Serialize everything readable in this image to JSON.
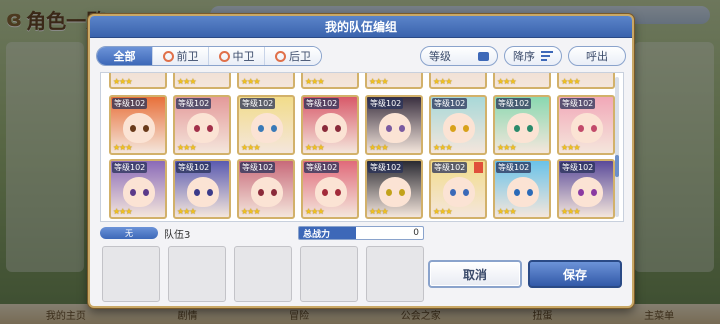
{
  "background": {
    "title": "角色一覧",
    "bottom_nav": [
      "我的主页",
      "剧情",
      "冒险",
      "公会之家",
      "扭蛋",
      "主菜单"
    ]
  },
  "dialog": {
    "title": "我的队伍编组",
    "tabs": [
      {
        "label": "全部",
        "active": true
      },
      {
        "label": "前卫",
        "active": false
      },
      {
        "label": "中卫",
        "active": false
      },
      {
        "label": "后卫",
        "active": false
      }
    ],
    "level_label": "等级",
    "sort_label": "降序",
    "call_label": "呼出",
    "level_prefix": "等级102",
    "party_tag": "无",
    "party_name": "队伍3",
    "power_label": "总战力",
    "power_value": "0",
    "cancel_label": "取消",
    "save_label": "保存"
  },
  "roster": {
    "partial_top_stars": [
      "★★★",
      "★★★",
      "★★★",
      "★★★",
      "★★★",
      "★★★",
      "★★★",
      "★★★"
    ],
    "row1": [
      {
        "level": "等级102",
        "stars": "★★★",
        "hair": "#e8703a",
        "eye": "#6a3a1a"
      },
      {
        "level": "等级102",
        "stars": "★★★",
        "hair": "#e49a9a",
        "eye": "#a2304a"
      },
      {
        "level": "等级102",
        "stars": "★★★",
        "hair": "#f2dc8a",
        "eye": "#3a7ab8"
      },
      {
        "level": "等级102",
        "stars": "★★★",
        "hair": "#d85a6a",
        "eye": "#8a2a3a"
      },
      {
        "level": "等级102",
        "stars": "★★★",
        "hair": "#3a3040",
        "eye": "#7a5aa0"
      },
      {
        "level": "等级102",
        "stars": "★★★",
        "hair": "#a8d8d8",
        "eye": "#d8a21a"
      },
      {
        "level": "等级102",
        "stars": "★★★",
        "hair": "#8ad8b0",
        "eye": "#2a8a6a"
      },
      {
        "level": "等级102",
        "stars": "★★★",
        "hair": "#f2a8b8",
        "eye": "#c24a6a"
      }
    ],
    "row2": [
      {
        "level": "等级102",
        "stars": "★★★",
        "hair": "#8a6ab8",
        "eye": "#5a3a8a",
        "flag": false
      },
      {
        "level": "等级102",
        "stars": "★★★",
        "hair": "#5a5ab0",
        "eye": "#3a3a8a",
        "flag": false
      },
      {
        "level": "等级102",
        "stars": "★★★",
        "hair": "#c86a7a",
        "eye": "#8a2a3a",
        "flag": false
      },
      {
        "level": "等级102",
        "stars": "★★★",
        "hair": "#e06a7a",
        "eye": "#a22a3a",
        "flag": false
      },
      {
        "level": "等级102",
        "stars": "★★★",
        "hair": "#2a2a32",
        "eye": "#c2a21a",
        "flag": false
      },
      {
        "level": "等级102",
        "stars": "★★★",
        "hair": "#f2dc8a",
        "eye": "#3a6ab8",
        "flag": true
      },
      {
        "level": "等级102",
        "stars": "★★★",
        "hair": "#6ac2e8",
        "eye": "#2a6ab8",
        "flag": false
      },
      {
        "level": "等级102",
        "stars": "★★★",
        "hair": "#5a4a9a",
        "eye": "#8a3aa2",
        "flag": false
      }
    ]
  },
  "colors": {
    "header_blue": "#3a63ad",
    "accent_gold": "#c9a866",
    "star": "#f2c21f"
  }
}
